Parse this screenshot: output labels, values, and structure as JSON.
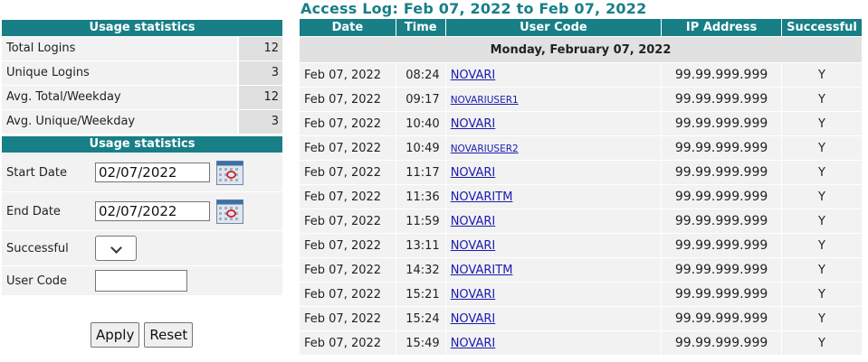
{
  "stats": {
    "header": "Usage statistics",
    "rows": [
      {
        "label": "Total Logins",
        "value": "12"
      },
      {
        "label": "Unique Logins",
        "value": "3"
      },
      {
        "label": "Avg. Total/Weekday",
        "value": "12"
      },
      {
        "label": "Avg. Unique/Weekday",
        "value": "3"
      }
    ]
  },
  "filters": {
    "header": "Usage statistics",
    "start_label": "Start Date",
    "start_value": "02/07/2022",
    "end_label": "End Date",
    "end_value": "02/07/2022",
    "successful_label": "Successful",
    "successful_value": "",
    "user_label": "User Code",
    "user_value": "",
    "apply_label": "Apply",
    "reset_label": "Reset"
  },
  "log": {
    "title": "Access Log: Feb 07, 2022 to Feb 07, 2022",
    "columns": [
      "Date",
      "Time",
      "User Code",
      "IP Address",
      "Successful"
    ],
    "day_header": "Monday, February 07, 2022",
    "rows": [
      {
        "date": "Feb 07, 2022",
        "time": "08:24",
        "user": "NOVARI",
        "ip": "99.99.999.999",
        "ok": "Y"
      },
      {
        "date": "Feb 07, 2022",
        "time": "09:17",
        "user": "NOVARIUSER1",
        "ip": "99.99.999.999",
        "ok": "Y"
      },
      {
        "date": "Feb 07, 2022",
        "time": "10:40",
        "user": "NOVARI",
        "ip": "99.99.999.999",
        "ok": "Y"
      },
      {
        "date": "Feb 07, 2022",
        "time": "10:49",
        "user": "NOVARIUSER2",
        "ip": "99.99.999.999",
        "ok": "Y"
      },
      {
        "date": "Feb 07, 2022",
        "time": "11:17",
        "user": "NOVARI",
        "ip": "99.99.999.999",
        "ok": "Y"
      },
      {
        "date": "Feb 07, 2022",
        "time": "11:36",
        "user": "NOVARITM",
        "ip": "99.99.999.999",
        "ok": "Y"
      },
      {
        "date": "Feb 07, 2022",
        "time": "11:59",
        "user": "NOVARI",
        "ip": "99.99.999.999",
        "ok": "Y"
      },
      {
        "date": "Feb 07, 2022",
        "time": "13:11",
        "user": "NOVARI",
        "ip": "99.99.999.999",
        "ok": "Y"
      },
      {
        "date": "Feb 07, 2022",
        "time": "14:32",
        "user": "NOVARITM",
        "ip": "99.99.999.999",
        "ok": "Y"
      },
      {
        "date": "Feb 07, 2022",
        "time": "15:21",
        "user": "NOVARI",
        "ip": "99.99.999.999",
        "ok": "Y"
      },
      {
        "date": "Feb 07, 2022",
        "time": "15:24",
        "user": "NOVARI",
        "ip": "99.99.999.999",
        "ok": "Y"
      },
      {
        "date": "Feb 07, 2022",
        "time": "15:49",
        "user": "NOVARI",
        "ip": "99.99.999.999",
        "ok": "Y"
      }
    ]
  },
  "icons": {
    "calendar": "calendar-icon",
    "dropdown": "chevron-down-icon"
  },
  "colors": {
    "header_bg": "#187f87",
    "link": "#1a1ab0",
    "row_bg": "#f2f2f2"
  }
}
